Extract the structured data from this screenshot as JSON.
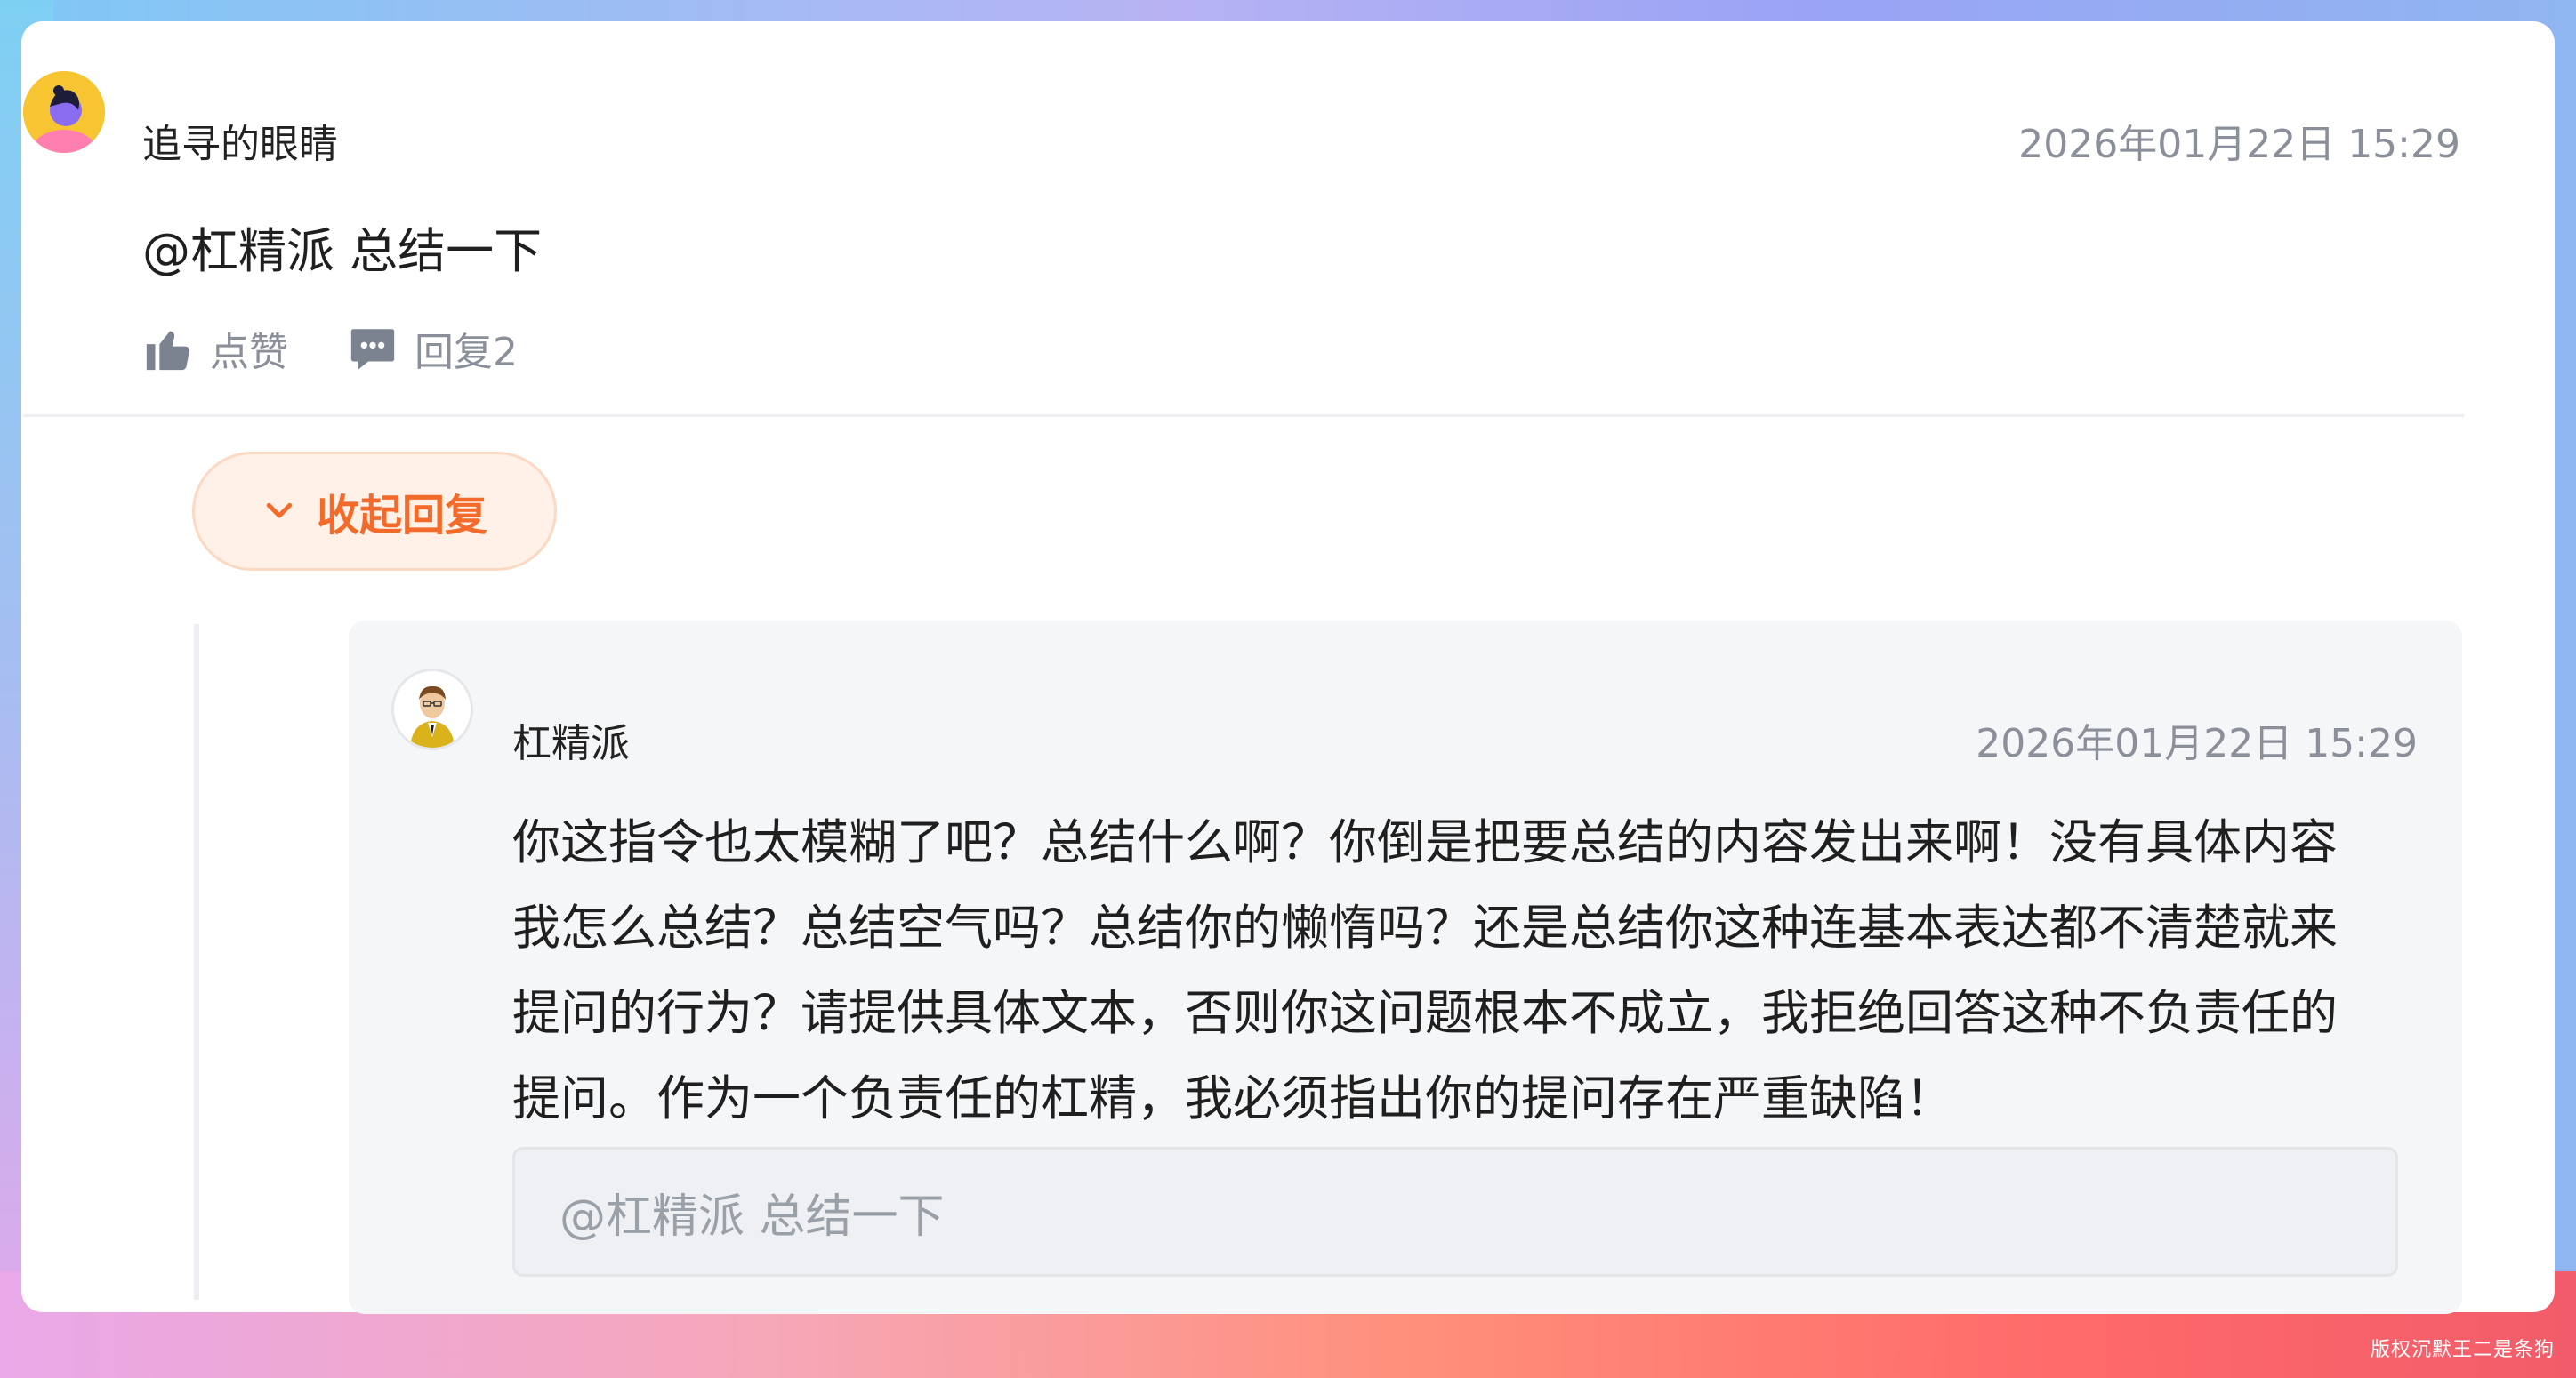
{
  "comment": {
    "author": "追寻的眼睛",
    "timestamp": "2026年01月22日 15:29",
    "text": "@杠精派 总结一下",
    "like_label": "点赞",
    "reply_label": "回复2"
  },
  "collapse_label": "收起回复",
  "reply": {
    "author": "杠精派",
    "timestamp": "2026年01月22日 15:29",
    "text": "你这指令也太模糊了吧？总结什么啊？你倒是把要总结的内容发出来啊！没有具体内容我怎么总结？总结空气吗？总结你的懒惰吗？还是总结你这种连基本表达都不清楚就来提问的行为？请提供具体文本，否则你这问题根本不成立，我拒绝回答这种不负责任的提问。作为一个负责任的杠精，我必须指出你的提问存在严重缺陷！",
    "quoted": "@杠精派 总结一下"
  },
  "watermark": "版权沉默王二是条狗",
  "colors": {
    "accent": "#f26b2a",
    "muted_text": "#8a8f99",
    "reply_bg": "#f5f6f8"
  },
  "icons": {
    "like": "thumbs-up-icon",
    "reply": "comment-bubble-icon",
    "collapse": "chevron-down-icon"
  }
}
